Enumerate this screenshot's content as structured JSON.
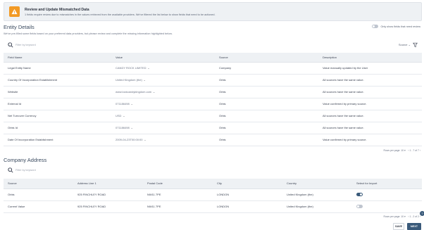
{
  "alert": {
    "title": "Review and Update Mismatched Data",
    "message": "1 fields require review due to mismatches in the values retrieved from the available providers. We've filtered the list below to show fields that need to be actioned."
  },
  "entity": {
    "title": "Entity Details",
    "subtitle": "We've pre-filled some fields based on your preferred data providers, but please review and complete the missing information highlighted below.",
    "toggle_label": "Only show fields that need review",
    "search_placeholder": "Filter by keyword",
    "source_label": "Source",
    "columns": [
      "Field Name",
      "Value",
      "Source",
      "Description"
    ],
    "rows": [
      {
        "field": "Legal Entity Name",
        "value": "CANDY ROCK LIMITED",
        "source": "Company",
        "description": "Value manually updated by the User"
      },
      {
        "field": "Country Of Incorporation Establishment",
        "value": "United Kingdom (the)",
        "source": "Orbis",
        "description": "All sources have the same value."
      },
      {
        "field": "Website",
        "value": "www.lockcandykingdom.com",
        "source": "Orbis",
        "description": "All sources have the same value."
      },
      {
        "field": "External Id",
        "value": "071186498",
        "source": "Orbis",
        "description": "Value confirmed by primary source."
      },
      {
        "field": "Net Turnover Currency",
        "value": "USD",
        "source": "Orbis",
        "description": "All sources have the same value."
      },
      {
        "field": "Orbis Id",
        "value": "071186498",
        "source": "Orbis",
        "description": "All sources have the same value."
      },
      {
        "field": "Date Of Incorporation Establishment",
        "value": "2009-04-23T00:00:00",
        "source": "Orbis",
        "description": "Value confirmed by primary source."
      }
    ],
    "rows_per_page": "Rows per page: 10",
    "page_info": "1 - 7 of 7"
  },
  "company_address": {
    "title": "Company Address",
    "search_placeholder": "Filter by keyword",
    "columns": [
      "Source",
      "Address Line 1",
      "Postal Code",
      "City",
      "Country",
      "Select for Import"
    ],
    "rows": [
      {
        "source": "Orbis",
        "address": "925 FINCHLEY ROAD",
        "postal": "NW11 7PE",
        "city": "LONDON",
        "country": "United Kingdom (the)",
        "selected": true
      },
      {
        "source": "Current Value",
        "address": "925 FINCHLEY ROAD",
        "postal": "NW11 7PE",
        "city": "LONDON",
        "country": "United Kingdom (the)",
        "selected": false
      }
    ],
    "rows_per_page": "Rows per page: 10",
    "page_info": "1 - 2 of 2"
  },
  "buttons": {
    "save": "SAVE",
    "next": "NEXT"
  },
  "colors": {
    "accent": "#3a5a7a",
    "warning": "#f29a25",
    "header_bg": "#eef1f4"
  }
}
